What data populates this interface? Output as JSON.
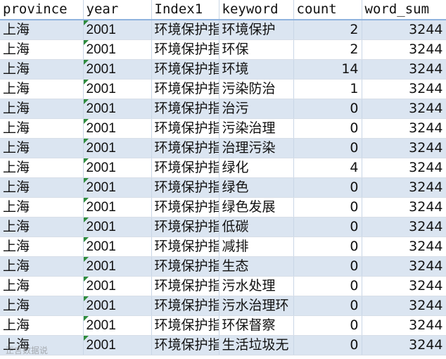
{
  "columns": [
    "province",
    "year",
    "Index1",
    "keyword",
    "count",
    "word_sum"
  ],
  "rows": [
    [
      "上海",
      "2001",
      "环境保护指",
      "环境保护",
      "2",
      "3244"
    ],
    [
      "上海",
      "2001",
      "环境保护指",
      "环保",
      "2",
      "3244"
    ],
    [
      "上海",
      "2001",
      "环境保护指",
      "环境",
      "14",
      "3244"
    ],
    [
      "上海",
      "2001",
      "环境保护指",
      "污染防治",
      "1",
      "3244"
    ],
    [
      "上海",
      "2001",
      "环境保护指",
      "治污",
      "0",
      "3244"
    ],
    [
      "上海",
      "2001",
      "环境保护指",
      "污染治理",
      "0",
      "3244"
    ],
    [
      "上海",
      "2001",
      "环境保护指",
      "治理污染",
      "0",
      "3244"
    ],
    [
      "上海",
      "2001",
      "环境保护指",
      "绿化",
      "4",
      "3244"
    ],
    [
      "上海",
      "2001",
      "环境保护指",
      "绿色",
      "0",
      "3244"
    ],
    [
      "上海",
      "2001",
      "环境保护指",
      "绿色发展",
      "0",
      "3244"
    ],
    [
      "上海",
      "2001",
      "环境保护指",
      "低碳",
      "0",
      "3244"
    ],
    [
      "上海",
      "2001",
      "环境保护指",
      "减排",
      "0",
      "3244"
    ],
    [
      "上海",
      "2001",
      "环境保护指",
      "生态",
      "0",
      "3244"
    ],
    [
      "上海",
      "2001",
      "环境保护指",
      "污水处理",
      "0",
      "3244"
    ],
    [
      "上海",
      "2001",
      "环境保护指",
      "污水治理环",
      "0",
      "3244"
    ],
    [
      "上海",
      "2001",
      "环境保护指",
      "环保督察",
      "0",
      "3244"
    ],
    [
      "上海",
      "2001",
      "环境保护指",
      "生活垃圾无",
      "0",
      "3244"
    ]
  ],
  "watermark": "正言数据说"
}
